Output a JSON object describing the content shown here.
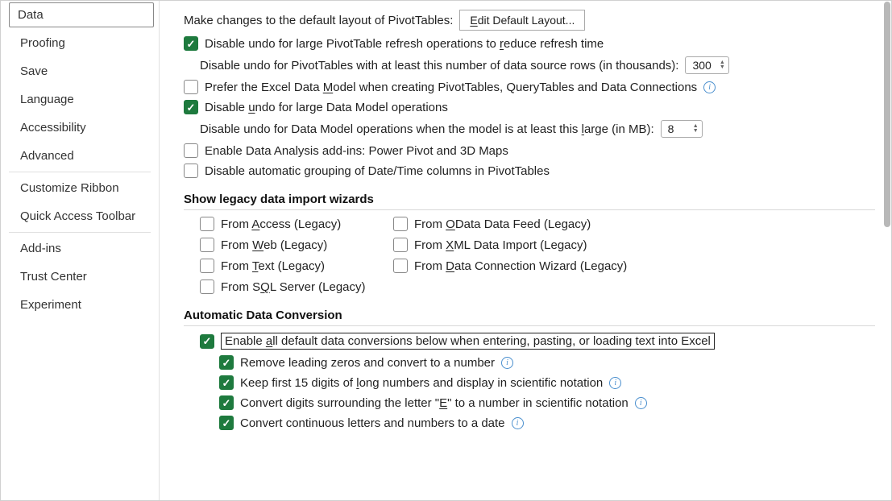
{
  "sidebar": {
    "items": [
      {
        "label": "Data",
        "selected": true
      },
      {
        "label": "Proofing"
      },
      {
        "label": "Save"
      },
      {
        "label": "Language"
      },
      {
        "label": "Accessibility"
      },
      {
        "label": "Advanced"
      },
      {
        "sep": true
      },
      {
        "label": "Customize Ribbon"
      },
      {
        "label": "Quick Access Toolbar"
      },
      {
        "sep": true
      },
      {
        "label": "Add-ins"
      },
      {
        "label": "Trust Center"
      },
      {
        "label": "Experiment"
      }
    ]
  },
  "main": {
    "pivot_intro": "Make changes to the default layout of PivotTables:",
    "edit_layout_btn": "Edit Default Layout...",
    "disable_undo_pivot": "Disable undo for large PivotTable refresh operations to reduce refresh time",
    "disable_undo_rows_label": "Disable undo for PivotTables with at least this number of data source rows (in thousands):",
    "disable_undo_rows_value": "300",
    "prefer_data_model": "Prefer the Excel Data Model when creating PivotTables, QueryTables and Data Connections",
    "disable_undo_dm": "Disable undo for large Data Model operations",
    "disable_undo_dm_size_label": "Disable undo for Data Model operations when the model is at least this large (in MB):",
    "disable_undo_dm_size_value": "8",
    "enable_addins": "Enable Data Analysis add-ins: Power Pivot and 3D Maps",
    "disable_grouping": "Disable automatic grouping of Date/Time columns in PivotTables",
    "section_legacy": "Show legacy data import wizards",
    "legacy": {
      "access": "From Access (Legacy)",
      "odata": "From OData Data Feed (Legacy)",
      "web": "From Web (Legacy)",
      "xml": "From XML Data Import (Legacy)",
      "text": "From Text (Legacy)",
      "dcw": "From Data Connection Wizard (Legacy)",
      "sql": "From SQL Server (Legacy)"
    },
    "section_auto": "Automatic Data Conversion",
    "auto": {
      "enable_all": "Enable all default data conversions below when entering, pasting, or loading text into Excel",
      "leading_zeros": "Remove leading zeros and convert to a number",
      "long_numbers": "Keep first 15 digits of long numbers and display in scientific notation",
      "letter_e": "Convert digits surrounding the letter \"E\" to a number in scientific notation",
      "letters_date": "Convert continuous letters and numbers to a date"
    }
  }
}
